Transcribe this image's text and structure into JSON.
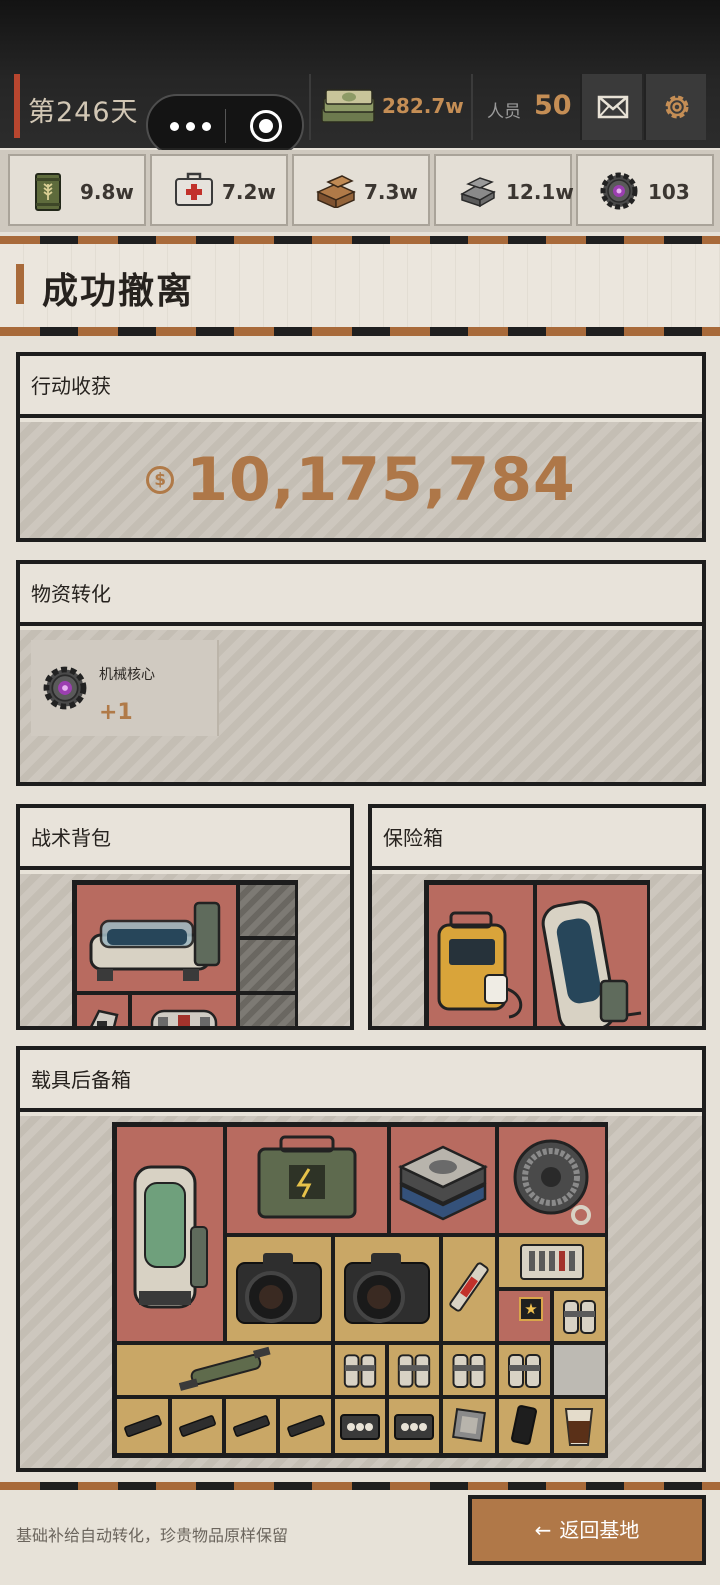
{
  "topbar": {
    "day": "第246天",
    "money": "282.7w",
    "staff_label": "人员",
    "staff_count": "50",
    "icons": [
      "more-icon",
      "target-icon",
      "money-stack-icon",
      "mail-icon",
      "gear-icon"
    ]
  },
  "resources": [
    {
      "name": "grain-can-icon",
      "value": "9.8w"
    },
    {
      "name": "medkit-icon",
      "value": "7.2w"
    },
    {
      "name": "wood-icon",
      "value": "7.3w"
    },
    {
      "name": "steel-ingot-icon",
      "value": "12.1w"
    },
    {
      "name": "mech-core-icon",
      "value": "103"
    }
  ],
  "banner": {
    "title": "成功撤离"
  },
  "earnings": {
    "header": "行动收获",
    "coin_symbol": "$",
    "amount": "10,175,784"
  },
  "conversion": {
    "header": "物资转化",
    "items": [
      {
        "name": "机械核心",
        "qty": "+1",
        "icon": "mech-core-icon"
      }
    ]
  },
  "backpack": {
    "header": "战术背包"
  },
  "safebox": {
    "header": "保险箱"
  },
  "trunk": {
    "header": "载具后备箱"
  },
  "footer": {
    "note": "基础补给自动转化，珍贵物品原样保留",
    "back_button": "返回基地",
    "back_arrow": "←"
  },
  "colors": {
    "accent": "#b07848",
    "rare_slot": "#b86b60",
    "common_slot": "#c9a766",
    "dark": "#1d1d1d"
  }
}
